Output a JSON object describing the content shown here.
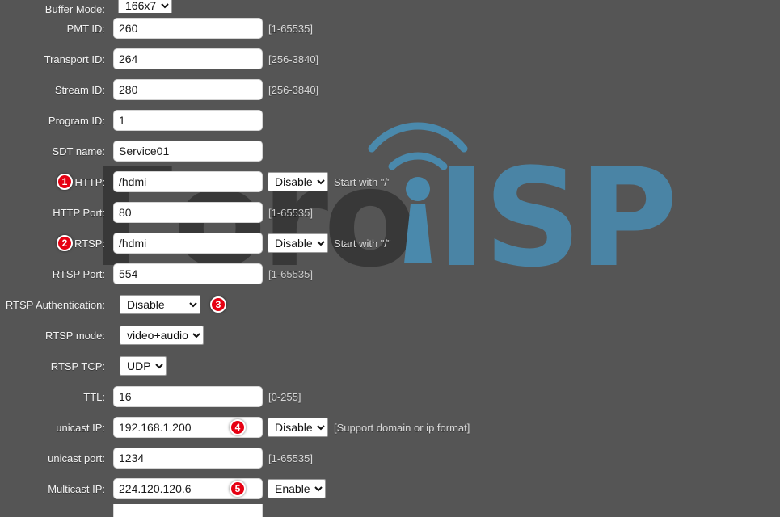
{
  "page": {
    "background_color": "#555555",
    "label_color": "#f2f2f2",
    "badge_color": "#e60012",
    "accent_color": "#4a89ac"
  },
  "watermark": {
    "text_dark": "Foro",
    "text_accent": "ISP",
    "tower_icon": "wifi-tower-icon"
  },
  "form": {
    "rows": [
      {
        "label": "Buffer Mode:",
        "type": "select",
        "value": "166x7",
        "options": [
          "166x7"
        ],
        "hint": "",
        "badge": null
      },
      {
        "label": "PMT ID:",
        "type": "text",
        "value": "260",
        "hint": "[1-65535]",
        "badge": null
      },
      {
        "label": "Transport ID:",
        "type": "text",
        "value": "264",
        "hint": "[256-3840]",
        "badge": null
      },
      {
        "label": "Stream ID:",
        "type": "text",
        "value": "280",
        "hint": "[256-3840]",
        "badge": null
      },
      {
        "label": "Program ID:",
        "type": "text",
        "value": "1",
        "hint": "",
        "badge": null
      },
      {
        "label": "SDT name:",
        "type": "text",
        "value": "Service01",
        "hint": "",
        "badge": null
      },
      {
        "label": "HTTP:",
        "type": "text-select",
        "value": "/hdmi",
        "select_value": "Disable",
        "options": [
          "Disable",
          "Enable"
        ],
        "hint": "Start with \"/\"",
        "badge": "1"
      },
      {
        "label": "HTTP Port:",
        "type": "text",
        "value": "80",
        "hint": "[1-65535]",
        "badge": null
      },
      {
        "label": "RTSP:",
        "type": "text-select",
        "value": "/hdmi",
        "select_value": "Disable",
        "options": [
          "Disable",
          "Enable"
        ],
        "hint": "Start with \"/\"",
        "badge": "2"
      },
      {
        "label": "RTSP Port:",
        "type": "text",
        "value": "554",
        "hint": "[1-65535]",
        "badge": null
      },
      {
        "label": "RTSP Authentication:",
        "type": "select",
        "value": "Disable",
        "options": [
          "Disable",
          "Enable"
        ],
        "hint": "",
        "badge": "3"
      },
      {
        "label": "RTSP mode:",
        "type": "select",
        "value": "video+audio",
        "options": [
          "video+audio",
          "video",
          "audio"
        ],
        "hint": "",
        "badge": null
      },
      {
        "label": "RTSP TCP:",
        "type": "select",
        "value": "UDP",
        "options": [
          "UDP",
          "TCP"
        ],
        "hint": "",
        "badge": null
      },
      {
        "label": "TTL:",
        "type": "text",
        "value": "16",
        "hint": "[0-255]",
        "badge": null
      },
      {
        "label": "unicast IP:",
        "type": "text-select",
        "value": "192.168.1.200",
        "select_value": "Disable",
        "options": [
          "Disable",
          "Enable"
        ],
        "hint": "[Support domain or ip format]",
        "badge": "4"
      },
      {
        "label": "unicast port:",
        "type": "text",
        "value": "1234",
        "hint": "[1-65535]",
        "badge": null
      },
      {
        "label": "Multicast IP:",
        "type": "text-select",
        "value": "224.120.120.6",
        "select_value": "Enable",
        "options": [
          "Disable",
          "Enable"
        ],
        "hint": "",
        "badge": "5"
      }
    ]
  }
}
